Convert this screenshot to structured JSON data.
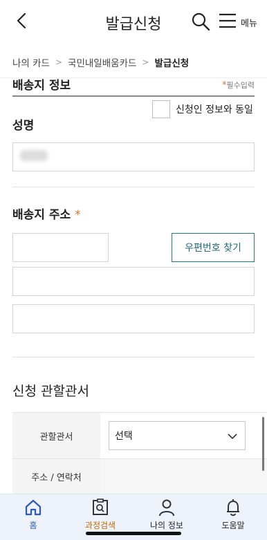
{
  "header": {
    "title": "발급신청",
    "menu_label": "메뉴"
  },
  "breadcrumb": [
    "나의 카드",
    "국민내일배움카드",
    "발급신청"
  ],
  "delivery_section": {
    "title": "배송지 정보",
    "required_note": "필수입력",
    "same_as_applicant_label": "신청인 정보와 동일",
    "same_as_applicant_checked": false
  },
  "name_field": {
    "label": "성명"
  },
  "address_field": {
    "label": "배송지 주소",
    "zip_value": "",
    "zip_button_label": "우편번호 찾기",
    "address1_value": "",
    "address2_value": ""
  },
  "office_section": {
    "title": "신청 관할관서",
    "rows": [
      {
        "header": "관할관서",
        "select_value": "선택"
      },
      {
        "header": "주소 / 연락처",
        "value": ""
      }
    ]
  },
  "tabbar": {
    "items": [
      {
        "label": "홈",
        "icon": "home-icon",
        "active": true
      },
      {
        "label": "과정검색",
        "icon": "course-search-icon"
      },
      {
        "label": "나의 정보",
        "icon": "person-icon"
      },
      {
        "label": "도움말",
        "icon": "bell-icon"
      }
    ]
  },
  "colors": {
    "accent_star": "#e5731f",
    "teal_button": "#1e7b84",
    "tab_active_home": "#2b59c3",
    "tab_active_search": "#c26a00",
    "tabbar_bg": "#eef3fb"
  }
}
